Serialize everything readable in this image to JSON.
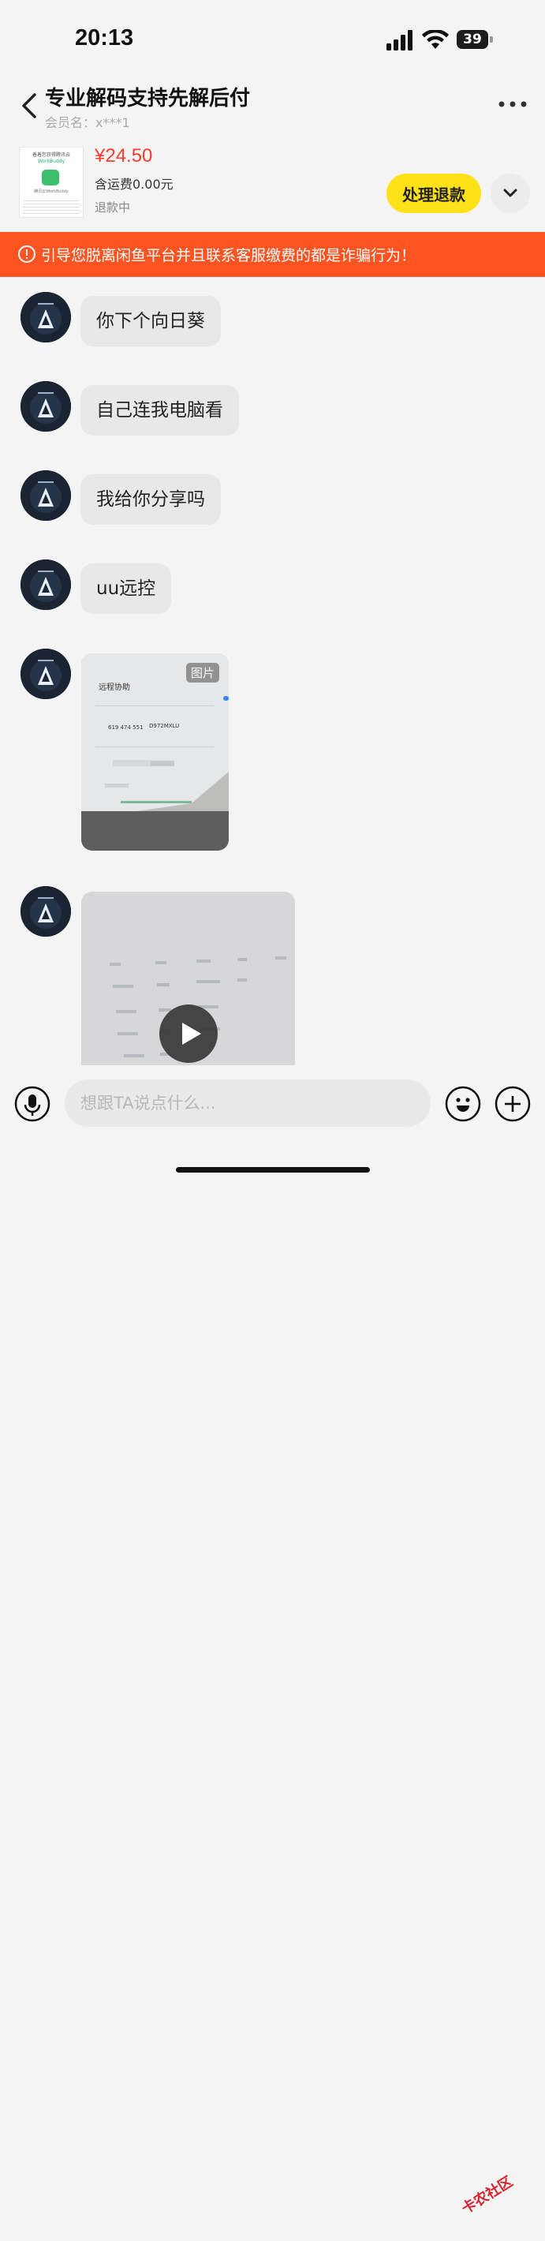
{
  "status_bar": {
    "time": "20:13",
    "battery": "39"
  },
  "header": {
    "title": "专业解码支持先解后付",
    "member": "会员名：x***1"
  },
  "product": {
    "thumb_line1": "着着您获得腾讯云",
    "thumb_line2": "WorkBuddy",
    "thumb_line3": "腾讯云WorkBuddy",
    "price": "¥24.50",
    "shipping": "含运费0.00元",
    "refund_status": "退款中",
    "refund_button": "处理退款"
  },
  "warning": {
    "text": "引导您脱离闲鱼平台并且联系客服缴费的都是诈骗行为！"
  },
  "messages": [
    {
      "type": "text",
      "text": "你下个向日葵"
    },
    {
      "type": "text",
      "text": "自己连我电脑看"
    },
    {
      "type": "text",
      "text": "我给你分享吗"
    },
    {
      "type": "text",
      "text": "uu远控"
    },
    {
      "type": "image",
      "label": "图片",
      "screen_title": "远程协助",
      "screen_device_code": "619 474 551",
      "screen_password": "D972MXLU"
    },
    {
      "type": "video"
    }
  ],
  "input": {
    "placeholder": "想跟TA说点什么..."
  },
  "watermark": "卡农社区",
  "colors": {
    "accent_yellow": "#ffe11a",
    "warning_orange": "#ff5422",
    "price_red": "#ff3b30"
  }
}
